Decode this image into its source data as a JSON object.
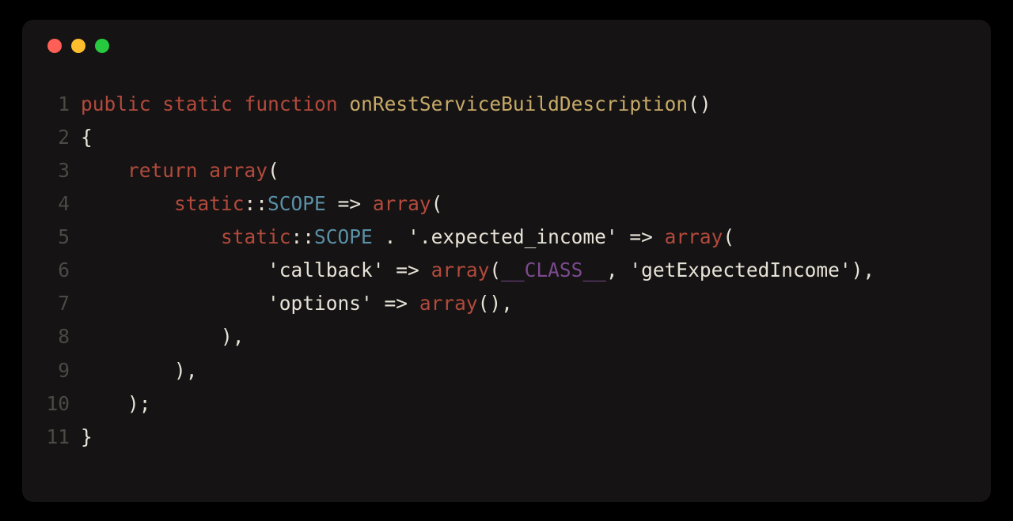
{
  "window": {
    "traffic_lights": [
      "red",
      "yellow",
      "green"
    ]
  },
  "code": {
    "language": "php",
    "lines": [
      {
        "n": "1",
        "tokens": [
          {
            "t": "public",
            "c": "keyword"
          },
          {
            "t": " ",
            "c": "punct"
          },
          {
            "t": "static",
            "c": "keyword"
          },
          {
            "t": " ",
            "c": "punct"
          },
          {
            "t": "function",
            "c": "keyword"
          },
          {
            "t": " ",
            "c": "punct"
          },
          {
            "t": "onRestServiceBuildDescription",
            "c": "function"
          },
          {
            "t": "()",
            "c": "punct"
          }
        ]
      },
      {
        "n": "2",
        "tokens": [
          {
            "t": "{",
            "c": "punct"
          }
        ]
      },
      {
        "n": "3",
        "tokens": [
          {
            "t": "    ",
            "c": "punct"
          },
          {
            "t": "return",
            "c": "keyword"
          },
          {
            "t": " ",
            "c": "punct"
          },
          {
            "t": "array",
            "c": "array"
          },
          {
            "t": "(",
            "c": "punct"
          }
        ]
      },
      {
        "n": "4",
        "tokens": [
          {
            "t": "        ",
            "c": "punct"
          },
          {
            "t": "static",
            "c": "keyword"
          },
          {
            "t": "::",
            "c": "punct"
          },
          {
            "t": "SCOPE",
            "c": "scope"
          },
          {
            "t": " ",
            "c": "punct"
          },
          {
            "t": "=>",
            "c": "arrow"
          },
          {
            "t": " ",
            "c": "punct"
          },
          {
            "t": "array",
            "c": "array"
          },
          {
            "t": "(",
            "c": "punct"
          }
        ]
      },
      {
        "n": "5",
        "tokens": [
          {
            "t": "            ",
            "c": "punct"
          },
          {
            "t": "static",
            "c": "keyword"
          },
          {
            "t": "::",
            "c": "punct"
          },
          {
            "t": "SCOPE",
            "c": "scope"
          },
          {
            "t": " . ",
            "c": "punct"
          },
          {
            "t": "'.expected_income'",
            "c": "string"
          },
          {
            "t": " ",
            "c": "punct"
          },
          {
            "t": "=>",
            "c": "arrow"
          },
          {
            "t": " ",
            "c": "punct"
          },
          {
            "t": "array",
            "c": "array"
          },
          {
            "t": "(",
            "c": "punct"
          }
        ]
      },
      {
        "n": "6",
        "tokens": [
          {
            "t": "                ",
            "c": "punct"
          },
          {
            "t": "'callback'",
            "c": "string"
          },
          {
            "t": " ",
            "c": "punct"
          },
          {
            "t": "=>",
            "c": "arrow"
          },
          {
            "t": " ",
            "c": "punct"
          },
          {
            "t": "array",
            "c": "array"
          },
          {
            "t": "(",
            "c": "punct"
          },
          {
            "t": "__CLASS__",
            "c": "const"
          },
          {
            "t": ", ",
            "c": "punct"
          },
          {
            "t": "'getExpectedIncome'",
            "c": "string"
          },
          {
            "t": "),",
            "c": "punct"
          }
        ]
      },
      {
        "n": "7",
        "tokens": [
          {
            "t": "                ",
            "c": "punct"
          },
          {
            "t": "'options'",
            "c": "string"
          },
          {
            "t": " ",
            "c": "punct"
          },
          {
            "t": "=>",
            "c": "arrow"
          },
          {
            "t": " ",
            "c": "punct"
          },
          {
            "t": "array",
            "c": "array"
          },
          {
            "t": "(),",
            "c": "punct"
          }
        ]
      },
      {
        "n": "8",
        "tokens": [
          {
            "t": "            ),",
            "c": "punct"
          }
        ]
      },
      {
        "n": "9",
        "tokens": [
          {
            "t": "        ),",
            "c": "punct"
          }
        ]
      },
      {
        "n": "10",
        "tokens": [
          {
            "t": "    );",
            "c": "punct"
          }
        ]
      },
      {
        "n": "11",
        "tokens": [
          {
            "t": "}",
            "c": "punct"
          }
        ]
      }
    ]
  }
}
